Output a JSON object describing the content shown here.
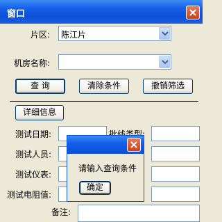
{
  "window": {
    "title": "窗口"
  },
  "form": {
    "area_label": "片区:",
    "area_value": "陈江片",
    "room_label": "机房名称:",
    "room_value": "",
    "query_button": "查 询",
    "clear_button": "清除条件",
    "cancel_filter_button": "撤销筛选",
    "details_button": "详细信息",
    "test_date_label": "测试日期:",
    "line_type_label": "批线类型:",
    "tester_label": "测试人员:",
    "instrument_label": "测试仪表:",
    "resistance_label": "测试电阻值:",
    "remark_label": "备注:"
  },
  "dialog": {
    "message": "请输入查询条件",
    "ok_button": "确定"
  }
}
